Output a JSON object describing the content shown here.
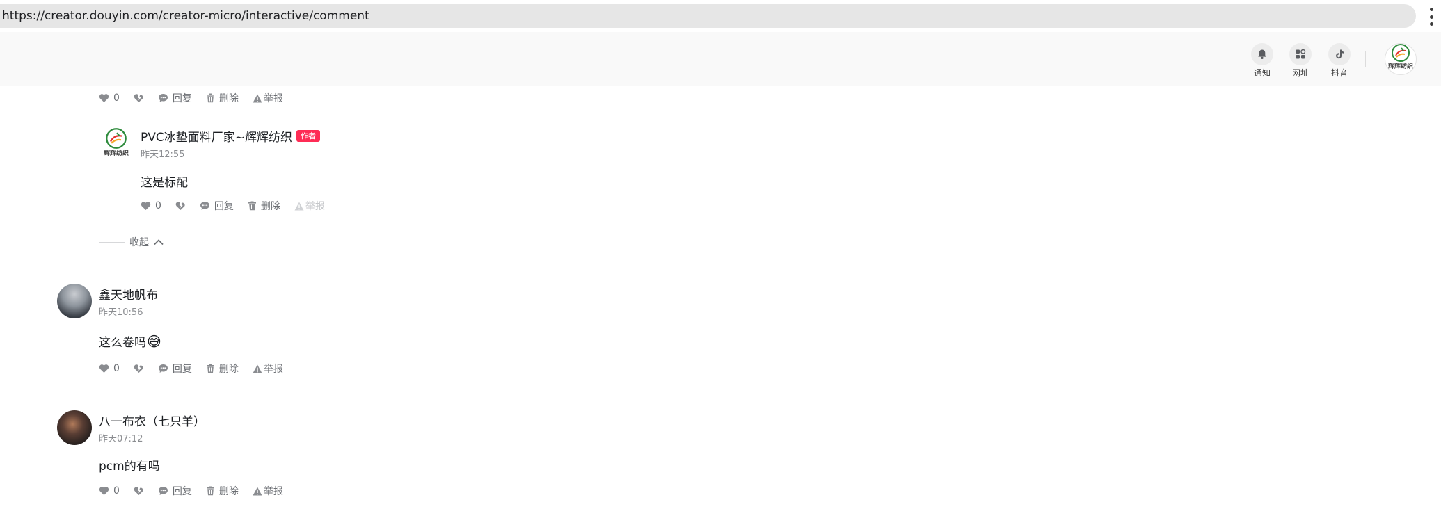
{
  "browser": {
    "url": "https://creator.douyin.com/creator-micro/interactive/comment"
  },
  "header": {
    "buttons": [
      {
        "label": "通知",
        "icon": "bell-icon"
      },
      {
        "label": "网址",
        "icon": "grid-icon"
      },
      {
        "label": "抖音",
        "icon": "tiktok-icon"
      }
    ],
    "avatar_logo_text": "辉辉纺织"
  },
  "action_labels": {
    "reply": "回复",
    "delete": "删除",
    "report": "举报"
  },
  "comments": [
    {
      "likes": "0"
    },
    {
      "author": "PVC冰垫面料厂家~辉辉纺织",
      "badge": "作者",
      "logo_text": "辉辉纺织",
      "time": "昨天12:55",
      "text": "这是标配",
      "likes": "0"
    },
    {
      "author": "鑫天地帆布",
      "time": "昨天10:56",
      "text": "这么卷吗",
      "emoji": "😅",
      "likes": "0"
    },
    {
      "author": "八一布衣（七只羊）",
      "time": "昨天07:12",
      "text": "pcm的有吗",
      "likes": "0"
    }
  ],
  "collapse_label": "收起",
  "colors": {
    "badge": "#fe2c55",
    "secondary_text": "#6b6e73",
    "header_bg": "#f9f9f9"
  }
}
